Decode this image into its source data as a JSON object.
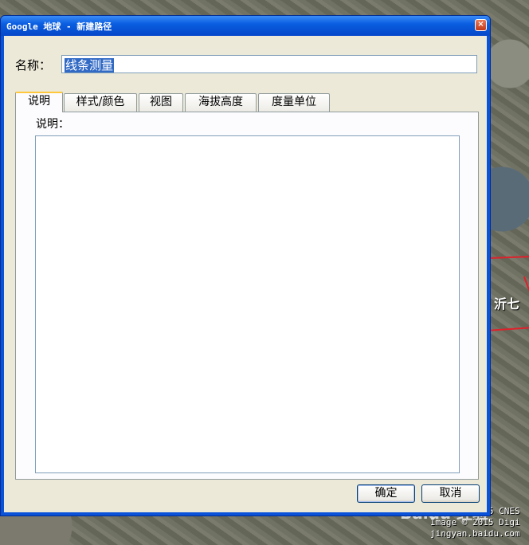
{
  "window": {
    "title": "Google 地球 - 新建路径",
    "close_label": "×"
  },
  "form": {
    "name_label": "名称：",
    "name_value": "线条测量"
  },
  "tabs": [
    {
      "label": "说明",
      "active": true
    },
    {
      "label": "样式/颜色",
      "active": false
    },
    {
      "label": "视图",
      "active": false
    },
    {
      "label": "海拔高度",
      "active": false
    },
    {
      "label": "度量单位",
      "active": false
    }
  ],
  "description": {
    "label": "说明：",
    "value": ""
  },
  "buttons": {
    "ok": "确定",
    "cancel": "取消"
  },
  "map": {
    "place_label": "沂七",
    "credits": [
      "Image © 2015 CNES",
      "Image © 2015 Digi"
    ],
    "watermark": "Baidu 经验",
    "watermark_url": "jingyan.baidu.com",
    "road_color": "#e0202a"
  }
}
